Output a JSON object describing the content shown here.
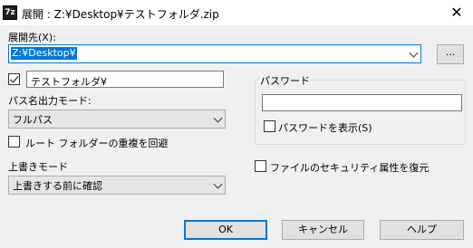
{
  "window": {
    "title": "展開 : Z:¥Desktop¥テストフォルダ.zip",
    "app_icon_text": "7z"
  },
  "extract_to": {
    "label": "展開先(X):",
    "value": "Z:¥Desktop¥",
    "browse_label": "..."
  },
  "subfolder": {
    "checked": true,
    "value": "テストフォルダ¥"
  },
  "path_mode": {
    "label": "パス名出力モード:",
    "value": "フルパス"
  },
  "eliminate_duplication": {
    "label": "ルート フォルダーの重複を回避",
    "checked": false
  },
  "overwrite_mode": {
    "label": "上書きモード",
    "value": "上書きする前に確認"
  },
  "password": {
    "group_label": "パスワード",
    "value": "",
    "show_label": "パスワードを表示(S)",
    "show_checked": false
  },
  "security": {
    "label": "ファイルのセキュリティ属性を復元",
    "checked": false
  },
  "buttons": {
    "ok": "OK",
    "cancel": "キャンセル",
    "help": "ヘルプ"
  }
}
